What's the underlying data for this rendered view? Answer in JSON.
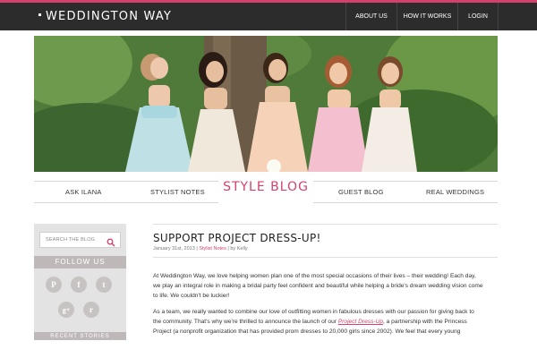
{
  "header": {
    "logo": "WEDDINGTON WAY",
    "nav": [
      {
        "label": "ABOUT US"
      },
      {
        "label": "HOW IT WORKS"
      },
      {
        "label": "LOGIN"
      }
    ]
  },
  "subnav": {
    "items": [
      {
        "label": "ASK ILANA"
      },
      {
        "label": "STYLIST NOTES"
      },
      {
        "label": "STYLE BLOG"
      },
      {
        "label": "GUEST BLOG"
      },
      {
        "label": "REAL WEDDINGS"
      }
    ],
    "active_index": 2
  },
  "sidebar": {
    "search_placeholder": "SEARCH THE BLOG",
    "follow_heading": "FOLLOW US",
    "social_icons": [
      "pinterest-icon",
      "facebook-icon",
      "twitter-icon",
      "google-plus-icon",
      "rss-icon"
    ],
    "social_glyphs": [
      "P",
      "f",
      "t",
      "g+",
      "r"
    ],
    "recent_heading": "RECENT STORIES"
  },
  "post": {
    "title": "SUPPORT PROJECT DRESS-UP!",
    "date": "January 31st, 2013",
    "category": "Stylist Notes",
    "author_prefix": "by",
    "author": "Kelly",
    "paragraph1": [
      "At Weddington Way, we love helping women plan one of the most special occasions of their lives – their wedding!  Each day,",
      "we play an integral role in making a bridal party feel confident and beautiful while helping a bride's dream wedding vision come",
      "to life.  We couldn't be luckier!"
    ],
    "paragraph2_line1": "As a team, we really wanted to combine our love of outfitting women in fabulous dresses with our passion for giving back to",
    "paragraph2_line2_pre": "the community. That's why we're thrilled to announce the launch of our",
    "paragraph2_link": "Project Dress-Up",
    "paragraph2_line2_post": ", a partnership with the Princess",
    "paragraph2_line3": "Project (a nonprofit organization that has provided prom dresses to 20,000 girls since 2002).  We feel that every young"
  },
  "colors": {
    "accent": "#d6406e",
    "header_bg": "#2c2c2c",
    "sidebar_bg": "#e3e3e3",
    "sidebar_band": "#bfb8b8"
  }
}
